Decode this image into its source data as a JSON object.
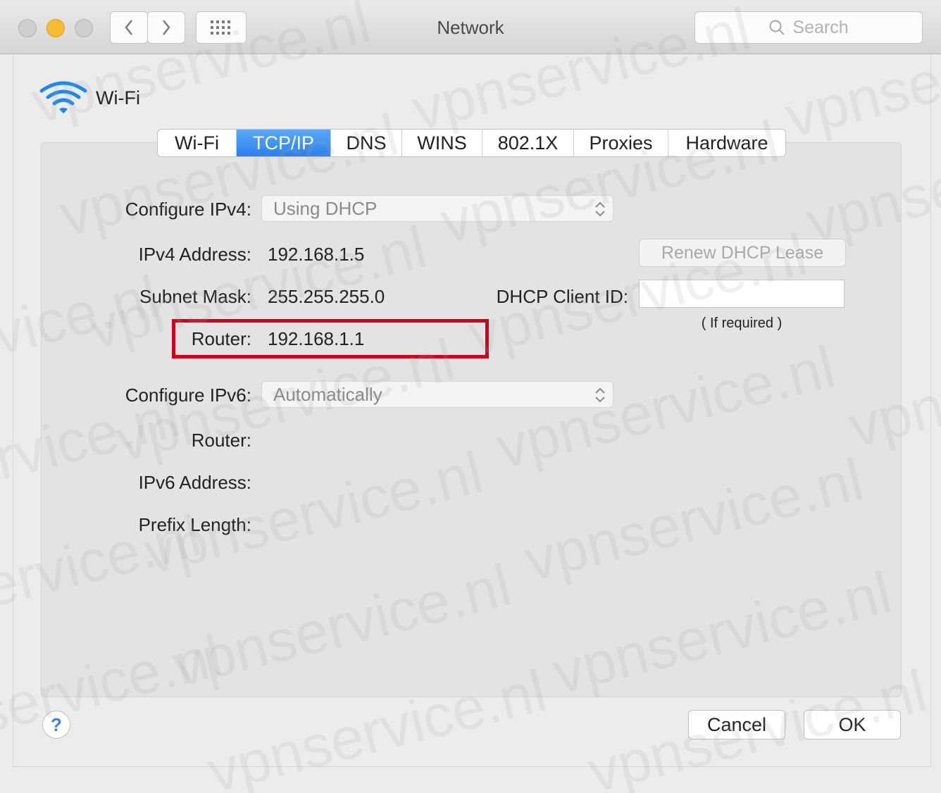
{
  "window": {
    "title": "Network",
    "search_placeholder": "Search"
  },
  "interface": {
    "name": "Wi-Fi",
    "icon": "wifi-icon"
  },
  "tabs": [
    {
      "label": "Wi-Fi",
      "active": false
    },
    {
      "label": "TCP/IP",
      "active": true
    },
    {
      "label": "DNS",
      "active": false
    },
    {
      "label": "WINS",
      "active": false
    },
    {
      "label": "802.1X",
      "active": false
    },
    {
      "label": "Proxies",
      "active": false
    },
    {
      "label": "Hardware",
      "active": false
    }
  ],
  "ipv4": {
    "configure_label": "Configure IPv4:",
    "configure_value": "Using DHCP",
    "address_label": "IPv4 Address:",
    "address_value": "192.168.1.5",
    "subnet_label": "Subnet Mask:",
    "subnet_value": "255.255.255.0",
    "router_label": "Router:",
    "router_value": "192.168.1.1",
    "renew_button": "Renew DHCP Lease",
    "client_id_label": "DHCP Client ID:",
    "client_id_value": "",
    "client_id_hint": "( If required )"
  },
  "ipv6": {
    "configure_label": "Configure IPv6:",
    "configure_value": "Automatically",
    "router_label": "Router:",
    "address_label": "IPv6 Address:",
    "prefix_label": "Prefix Length:"
  },
  "footer": {
    "help": "?",
    "cancel": "Cancel",
    "ok": "OK"
  },
  "watermark_text": "vpnservice.nl",
  "colors": {
    "accent": "#2a7ff0",
    "highlight": "#d0021b"
  }
}
